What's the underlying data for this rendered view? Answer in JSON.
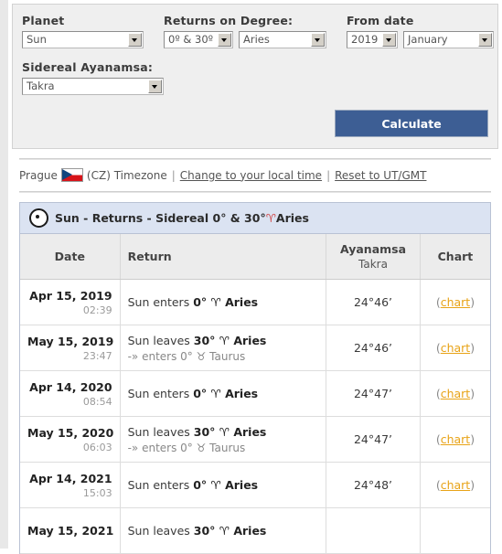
{
  "form": {
    "planet": {
      "label": "Planet",
      "value": "Sun"
    },
    "returns_on_degree": {
      "label": "Returns on Degree:",
      "degree_value": "0º & 30º",
      "sign_value": "Aries"
    },
    "from_date": {
      "label": "From date",
      "year_value": "2019",
      "month_value": "January"
    },
    "sidereal_ayanamsa": {
      "label": "Sidereal Ayanamsa:",
      "value": "Takra"
    },
    "calculate_label": "Calculate"
  },
  "timezone": {
    "city": "Prague",
    "flag_alt": "cz-flag",
    "country_code": "(CZ) Timezone",
    "separator": "|",
    "change_link": "Change to your local time",
    "reset_link": "Reset to UT/GMT"
  },
  "results": {
    "title_pre": "Sun - Returns - Sidereal 0° & 30° ",
    "title_glyph": "♈",
    "title_post": " Aries",
    "columns": {
      "date": "Date",
      "return": "Return",
      "ayanamsa": "Ayanamsa",
      "ayanamsa_sub": "Takra",
      "chart": "Chart"
    },
    "chart_link": "chart",
    "paren_open": "(",
    "paren_close": ")",
    "rows": [
      {
        "date": "Apr 15, 2019",
        "time": "02:39",
        "return_pre": "Sun enters ",
        "return_deg": "0° ",
        "return_glyph": "♈",
        "return_sign": "Aries",
        "return_sub": "",
        "ayanamsa": "24°46’",
        "chart": "chart"
      },
      {
        "date": "May 15, 2019",
        "time": "23:47",
        "return_pre": "Sun leaves ",
        "return_deg": "30° ",
        "return_glyph": "♈",
        "return_sign": "Aries",
        "return_sub": "-» enters 0° ♉ Taurus",
        "ayanamsa": "24°46’",
        "chart": "chart"
      },
      {
        "date": "Apr 14, 2020",
        "time": "08:54",
        "return_pre": "Sun enters ",
        "return_deg": "0° ",
        "return_glyph": "♈",
        "return_sign": "Aries",
        "return_sub": "",
        "ayanamsa": "24°47’",
        "chart": "chart"
      },
      {
        "date": "May 15, 2020",
        "time": "06:03",
        "return_pre": "Sun leaves ",
        "return_deg": "30° ",
        "return_glyph": "♈",
        "return_sign": "Aries",
        "return_sub": "-» enters 0° ♉ Taurus",
        "ayanamsa": "24°47’",
        "chart": "chart"
      },
      {
        "date": "Apr 14, 2021",
        "time": "15:03",
        "return_pre": "Sun enters ",
        "return_deg": "0° ",
        "return_glyph": "♈",
        "return_sign": "Aries",
        "return_sub": "",
        "ayanamsa": "24°48’",
        "chart": "chart"
      },
      {
        "date": "May 15, 2021",
        "time": "",
        "return_pre": "Sun leaves ",
        "return_deg": "30° ",
        "return_glyph": "♈",
        "return_sign": "Aries",
        "return_sub": "",
        "ayanamsa": "",
        "chart": ""
      }
    ]
  }
}
